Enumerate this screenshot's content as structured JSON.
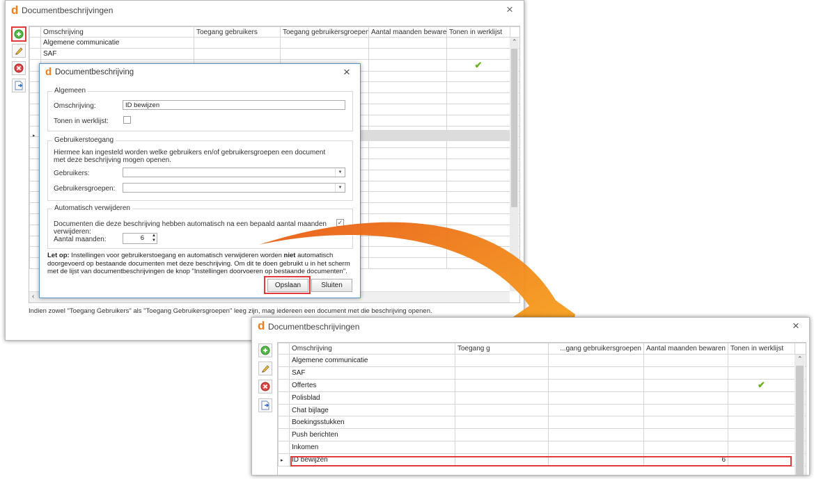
{
  "colors": {
    "logo": "#f07c1a",
    "highlight": "#e03a3a",
    "dialog_border": "#5a8fd0",
    "arrow_start": "#e85a14",
    "arrow_end": "#fbb320"
  },
  "back_window": {
    "logo": "d",
    "title": "Documentbeschrijvingen",
    "close_icon": "×",
    "toolbar": [
      {
        "name": "add-icon"
      },
      {
        "name": "edit-icon"
      },
      {
        "name": "delete-icon"
      },
      {
        "name": "export-icon"
      }
    ],
    "columns": [
      "Omschrijving",
      "Toegang gebruikers",
      "Toegang gebruikersgroepen",
      "Aantal maanden bewaren",
      "Tonen in werklijst"
    ],
    "rows": [
      {
        "name": "Algemene communicatie",
        "check": false
      },
      {
        "name": "SAF",
        "check": false
      },
      {
        "name": "",
        "check": true
      },
      {
        "name": "",
        "check": false
      },
      {
        "name": "",
        "check": false
      },
      {
        "name": "",
        "check": false
      },
      {
        "name": "",
        "check": false
      },
      {
        "name": "",
        "check": false
      },
      {
        "name": "",
        "check": false
      },
      {
        "name": "",
        "check": false
      },
      {
        "name": "",
        "check": false
      },
      {
        "name": "",
        "check": false
      },
      {
        "name": "",
        "check": false
      },
      {
        "name": "",
        "check": false
      },
      {
        "name": "",
        "check": false
      },
      {
        "name": "",
        "check": false
      },
      {
        "name": "",
        "check": false
      },
      {
        "name": "",
        "check": false
      },
      {
        "name": "",
        "check": false
      },
      {
        "name": "",
        "check": false
      },
      {
        "name": "",
        "check": false
      }
    ],
    "footer": "Indien zowel \"Toegang Gebruikers\" als \"Toegang Gebruikersgroepen\" leeg zijn, mag iedereen een document met die beschrijving openen."
  },
  "dialog": {
    "logo": "d",
    "title": "Documentbeschrijving",
    "close_icon": "×",
    "algemeen": {
      "caption": "Algemeen",
      "omschrijving_label": "Omschrijving:",
      "omschrijving_value": "ID bewijzen",
      "tonen_label": "Tonen in werklijst:"
    },
    "toegang": {
      "caption": "Gebruikerstoegang",
      "description": "Hiermee kan ingesteld worden welke gebruikers en/of gebruikersgroepen een document met deze beschrijving mogen openen.",
      "gebruikers_label": "Gebruikers:",
      "groepen_label": "Gebruikersgroepen:"
    },
    "verwijderen": {
      "caption": "Automatisch verwijderen",
      "auto_label": "Documenten die deze beschrijving hebben automatisch na een bepaald aantal maanden verwijderen:",
      "auto_checked": "✓",
      "maanden_label": "Aantal maanden:",
      "maanden_value": "6"
    },
    "note": {
      "prefix": "Let op:",
      "part1": " Instellingen voor gebruikerstoegang en automatisch verwijderen worden ",
      "bold": "niet",
      "part2": " automatisch doorgevoerd op bestaande documenten met deze beschrijving. Om dit te doen gebruikt u in het scherm met de lijst van documentbeschrijvingen de knop \"Instellingen doorvoeren op bestaande documenten\"."
    },
    "save_label": "Opslaan",
    "close_label": "Sluiten"
  },
  "front_window": {
    "logo": "d",
    "title": "Documentbeschrijvingen",
    "close_icon": "×",
    "columns": [
      "Omschrijving",
      "Toegang g",
      "...gang gebruikersgroepen",
      "Aantal maanden bewaren",
      "Tonen in werklijst"
    ],
    "rows": [
      {
        "name": "Algemene communicatie",
        "months": "",
        "check": false
      },
      {
        "name": "SAF",
        "months": "",
        "check": false
      },
      {
        "name": "Offertes",
        "months": "",
        "check": true
      },
      {
        "name": "Polisblad",
        "months": "",
        "check": false
      },
      {
        "name": "Chat bijlage",
        "months": "",
        "check": false
      },
      {
        "name": "Boekingsstukken",
        "months": "",
        "check": false
      },
      {
        "name": "Push berichten",
        "months": "",
        "check": false
      },
      {
        "name": "Inkomen",
        "months": "",
        "check": false
      },
      {
        "name": "ID bewijzen",
        "months": "6",
        "check": false
      }
    ]
  }
}
